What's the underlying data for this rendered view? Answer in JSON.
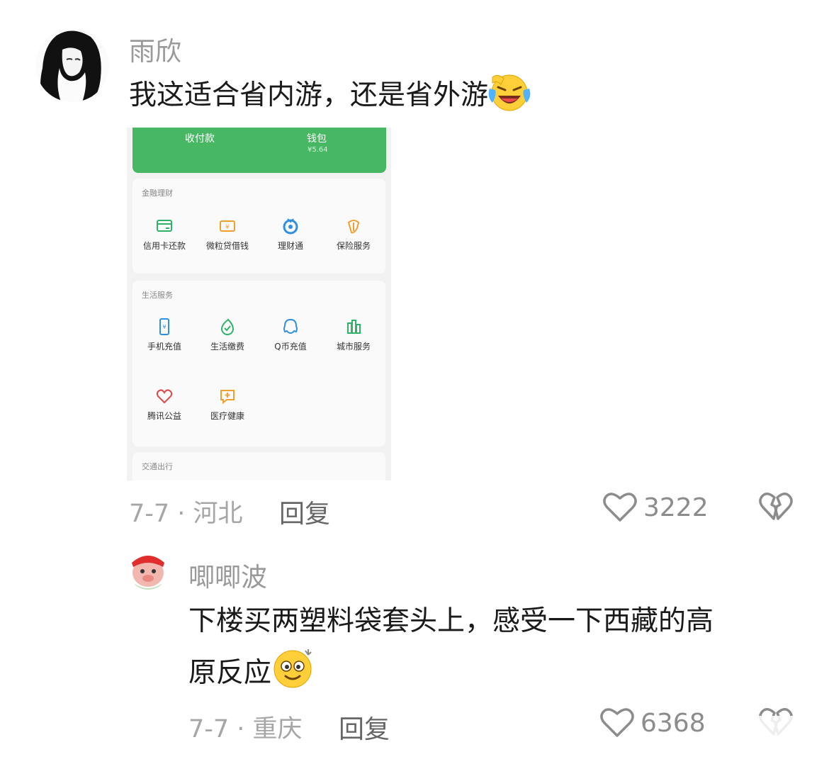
{
  "comments": [
    {
      "username": "雨欣",
      "text": "我这适合省内游，还是省外游",
      "emoji": "laughing-tears-emoji",
      "date_location": "7-7 · 河北",
      "reply_label": "回复",
      "likes": "3222"
    },
    {
      "username": "唧唧波",
      "text_line1": "下楼买两塑料袋套头上，感受一下西藏的高",
      "text_line2": "原反应",
      "emoji": "dizzy-smile-emoji",
      "date_location": "7-7 · 重庆",
      "reply_label": "回复",
      "likes": "6368"
    }
  ],
  "screenshot": {
    "top_bar": {
      "pay_label": "收付款",
      "wallet_label": "钱包",
      "wallet_balance": "¥5.64"
    },
    "finance": {
      "title": "金融理财",
      "items": [
        {
          "label": "信用卡还款",
          "icon": "card-icon"
        },
        {
          "label": "微粒贷借钱",
          "icon": "loan-icon"
        },
        {
          "label": "理财通",
          "icon": "wealth-icon"
        },
        {
          "label": "保险服务",
          "icon": "insurance-icon"
        }
      ]
    },
    "life": {
      "title": "生活服务",
      "items": [
        {
          "label": "手机充值",
          "icon": "phone-icon"
        },
        {
          "label": "生活缴费",
          "icon": "bill-icon"
        },
        {
          "label": "Q币充值",
          "icon": "qq-icon"
        },
        {
          "label": "城市服务",
          "icon": "city-icon"
        },
        {
          "label": "腾讯公益",
          "icon": "charity-icon"
        },
        {
          "label": "医疗健康",
          "icon": "medical-icon"
        }
      ]
    },
    "transport": {
      "title": "交通出行"
    }
  },
  "colors": {
    "green": "#47b764",
    "muted": "#a6a6a6"
  }
}
